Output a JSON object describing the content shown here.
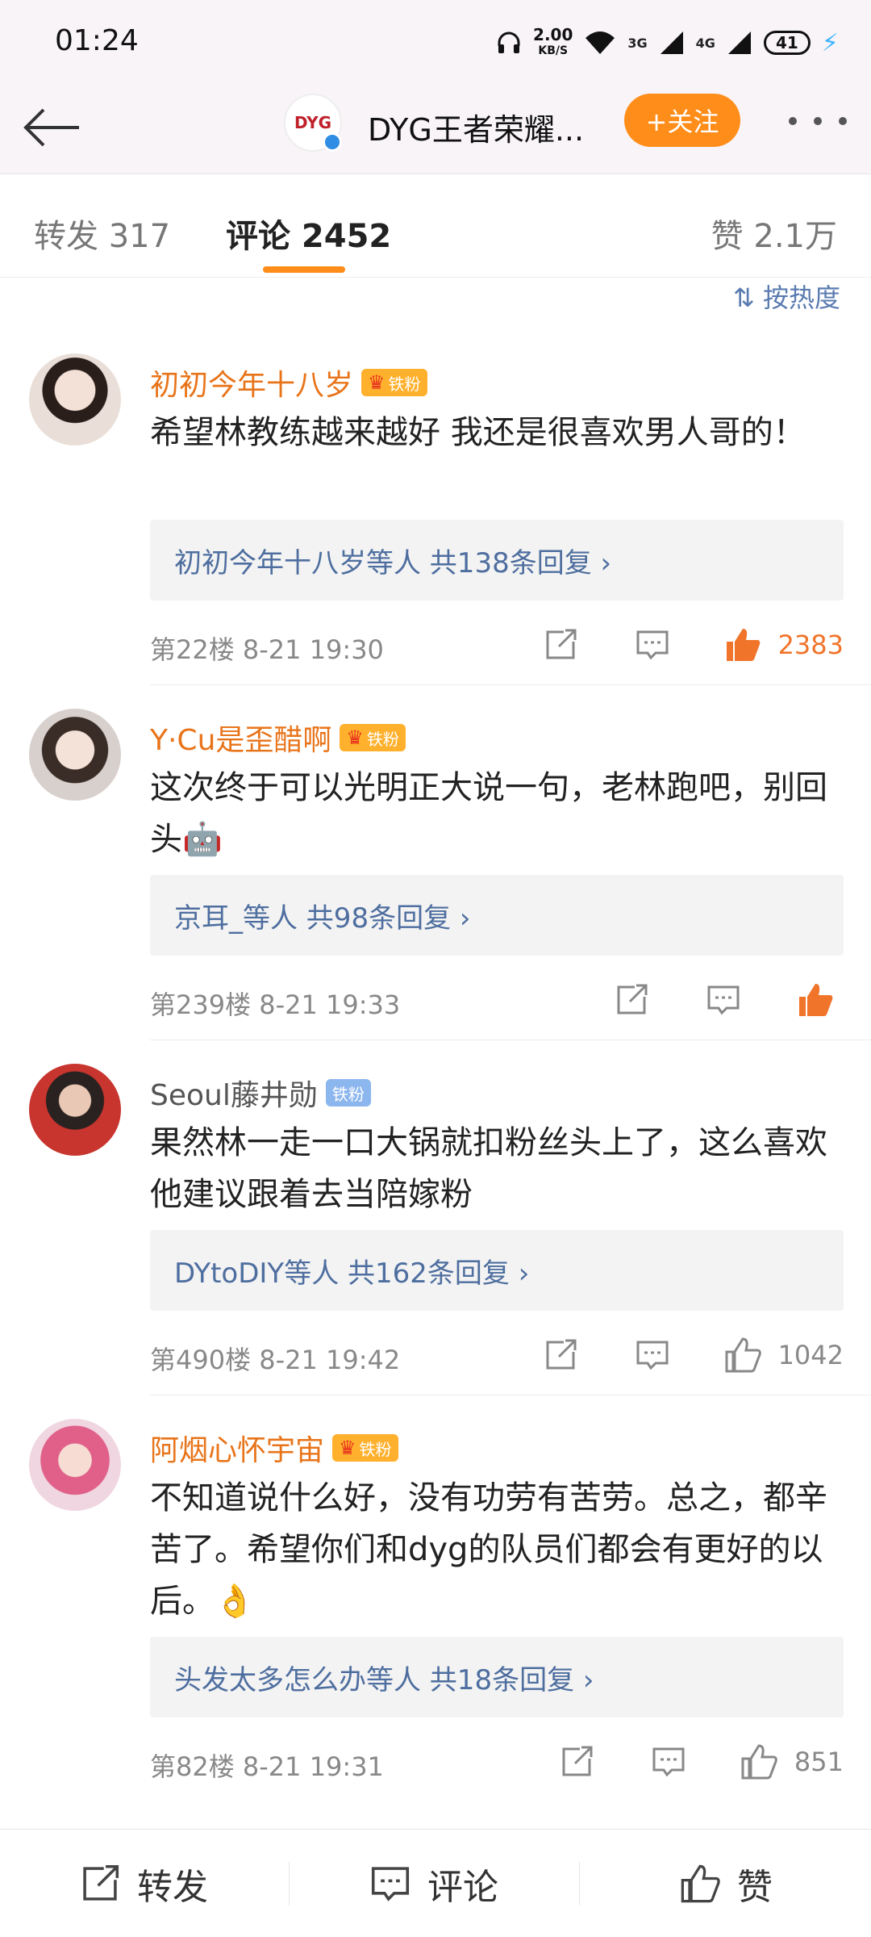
{
  "status_bar": {
    "time": "01:24",
    "net_speed_value": "2.00",
    "net_speed_unit": "KB/S",
    "battery": "41",
    "signal_labels": [
      "3G",
      "4G"
    ]
  },
  "header": {
    "title": "DYG王者荣耀...",
    "follow_label": "+关注",
    "avatar_text": "DYG"
  },
  "tabs": {
    "repost": "转发 317",
    "comments": "评论 2452",
    "likes": "赞 2.1万"
  },
  "sort_label": "按热度",
  "comments": [
    {
      "name": "初初今年十八岁",
      "badge": "铁粉",
      "text": "希望林教练越来越好 我还是很喜欢男人哥的！",
      "replies": "初初今年十八岁等人  共138条回复 ›",
      "floor": "第22楼  8-21 19:30",
      "likes": "2383",
      "liked": true
    },
    {
      "name": "Y·Cu是歪醋啊",
      "badge": "铁粉",
      "text": "这次终于可以光明正大说一句，老林跑吧，别回头🤖",
      "replies": "京耳_等人  共98条回复 ›",
      "floor": "第239楼  8-21 19:33",
      "likes": "",
      "liked": true
    },
    {
      "name": "Seoul藤井勋",
      "badge": "铁粉",
      "text": "果然林一走一口大锅就扣粉丝头上了，这么喜欢他建议跟着去当陪嫁粉",
      "replies": "DYtoDIY等人  共162条回复 ›",
      "floor": "第490楼  8-21 19:42",
      "likes": "1042",
      "liked": false
    },
    {
      "name": "阿烟心怀宇宙",
      "badge": "铁粉",
      "text": "不知道说什么好，没有功劳有苦劳。总之，都辛苦了。希望你们和dyg的队员们都会有更好的以后。👌",
      "replies": "头发太多怎么办等人  共18条回复 ›",
      "floor": "第82楼  8-21 19:31",
      "likes": "851",
      "liked": false
    }
  ],
  "bottom_bar": {
    "repost": "转发",
    "comment": "评论",
    "like": "赞"
  },
  "colors": {
    "accent": "#ff8d1a",
    "name_orange": "#e8741a",
    "link_blue": "#4e6e9f",
    "like_orange": "#f0742a"
  }
}
